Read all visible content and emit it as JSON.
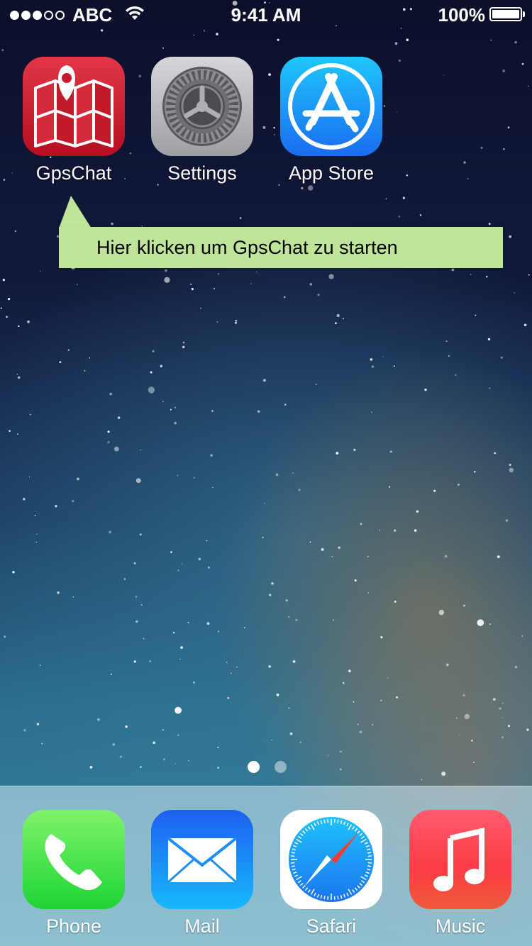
{
  "status_bar": {
    "carrier": "ABC",
    "signal_strength_dots": 3,
    "signal_total_dots": 5,
    "time": "9:41 AM",
    "battery_percent": "100%",
    "icons": [
      "wifi-icon",
      "battery-icon"
    ]
  },
  "home_apps": [
    {
      "label": "GpsChat",
      "icon": "gpschat-map-icon"
    },
    {
      "label": "Settings",
      "icon": "gear-icon"
    },
    {
      "label": "App Store",
      "icon": "app-store-icon"
    }
  ],
  "callout": {
    "text": "Hier klicken um GpsChat zu starten",
    "background": "#bfe59a"
  },
  "page_indicator": {
    "current_page": 1,
    "total_pages": 2
  },
  "dock_apps": [
    {
      "label": "Phone",
      "icon": "phone-icon"
    },
    {
      "label": "Mail",
      "icon": "mail-icon"
    },
    {
      "label": "Safari",
      "icon": "compass-icon"
    },
    {
      "label": "Music",
      "icon": "music-note-icon"
    }
  ],
  "colors": {
    "gpschat": "#c61a2b",
    "settings": "#a8aaaf",
    "app_store": "#1a8af5",
    "phone": "#3adb46",
    "mail": "#1a8cf5",
    "music": "#fc3c44"
  }
}
